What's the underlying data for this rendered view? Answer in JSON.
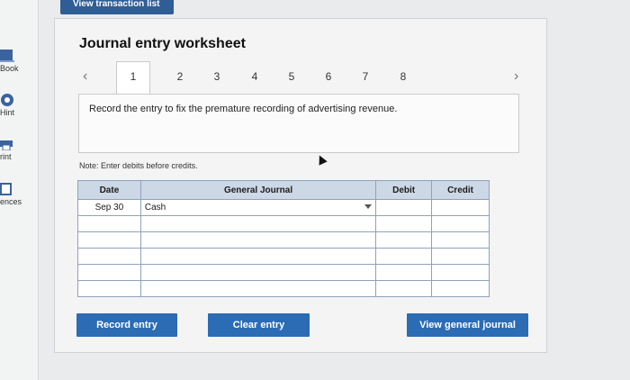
{
  "header": {
    "top_tab_label": "View transaction list"
  },
  "rail": {
    "items": [
      {
        "label": "Book",
        "icon": "book-icon"
      },
      {
        "label": "Hint",
        "icon": "hint-icon"
      },
      {
        "label": "rint",
        "icon": "print-icon"
      },
      {
        "label": "ences",
        "icon": "references-icon"
      }
    ]
  },
  "worksheet": {
    "title": "Journal entry worksheet",
    "tabs": [
      "1",
      "2",
      "3",
      "4",
      "5",
      "6",
      "7",
      "8"
    ],
    "active_tab": "1",
    "prompt": "Record the entry to fix the premature recording of advertising revenue.",
    "note": "Note: Enter debits before credits."
  },
  "table": {
    "headers": {
      "date": "Date",
      "account": "General Journal",
      "debit": "Debit",
      "credit": "Credit"
    },
    "rows": [
      {
        "date": "Sep 30",
        "account": "Cash",
        "debit": "",
        "credit": ""
      },
      {
        "date": "",
        "account": "",
        "debit": "",
        "credit": ""
      },
      {
        "date": "",
        "account": "",
        "debit": "",
        "credit": ""
      },
      {
        "date": "",
        "account": "",
        "debit": "",
        "credit": ""
      },
      {
        "date": "",
        "account": "",
        "debit": "",
        "credit": ""
      },
      {
        "date": "",
        "account": "",
        "debit": "",
        "credit": ""
      }
    ]
  },
  "buttons": {
    "record": "Record entry",
    "clear": "Clear entry",
    "view_general": "View general journal"
  },
  "colors": {
    "accent": "#2b6cb5",
    "header_bg": "#cdd8e6"
  }
}
